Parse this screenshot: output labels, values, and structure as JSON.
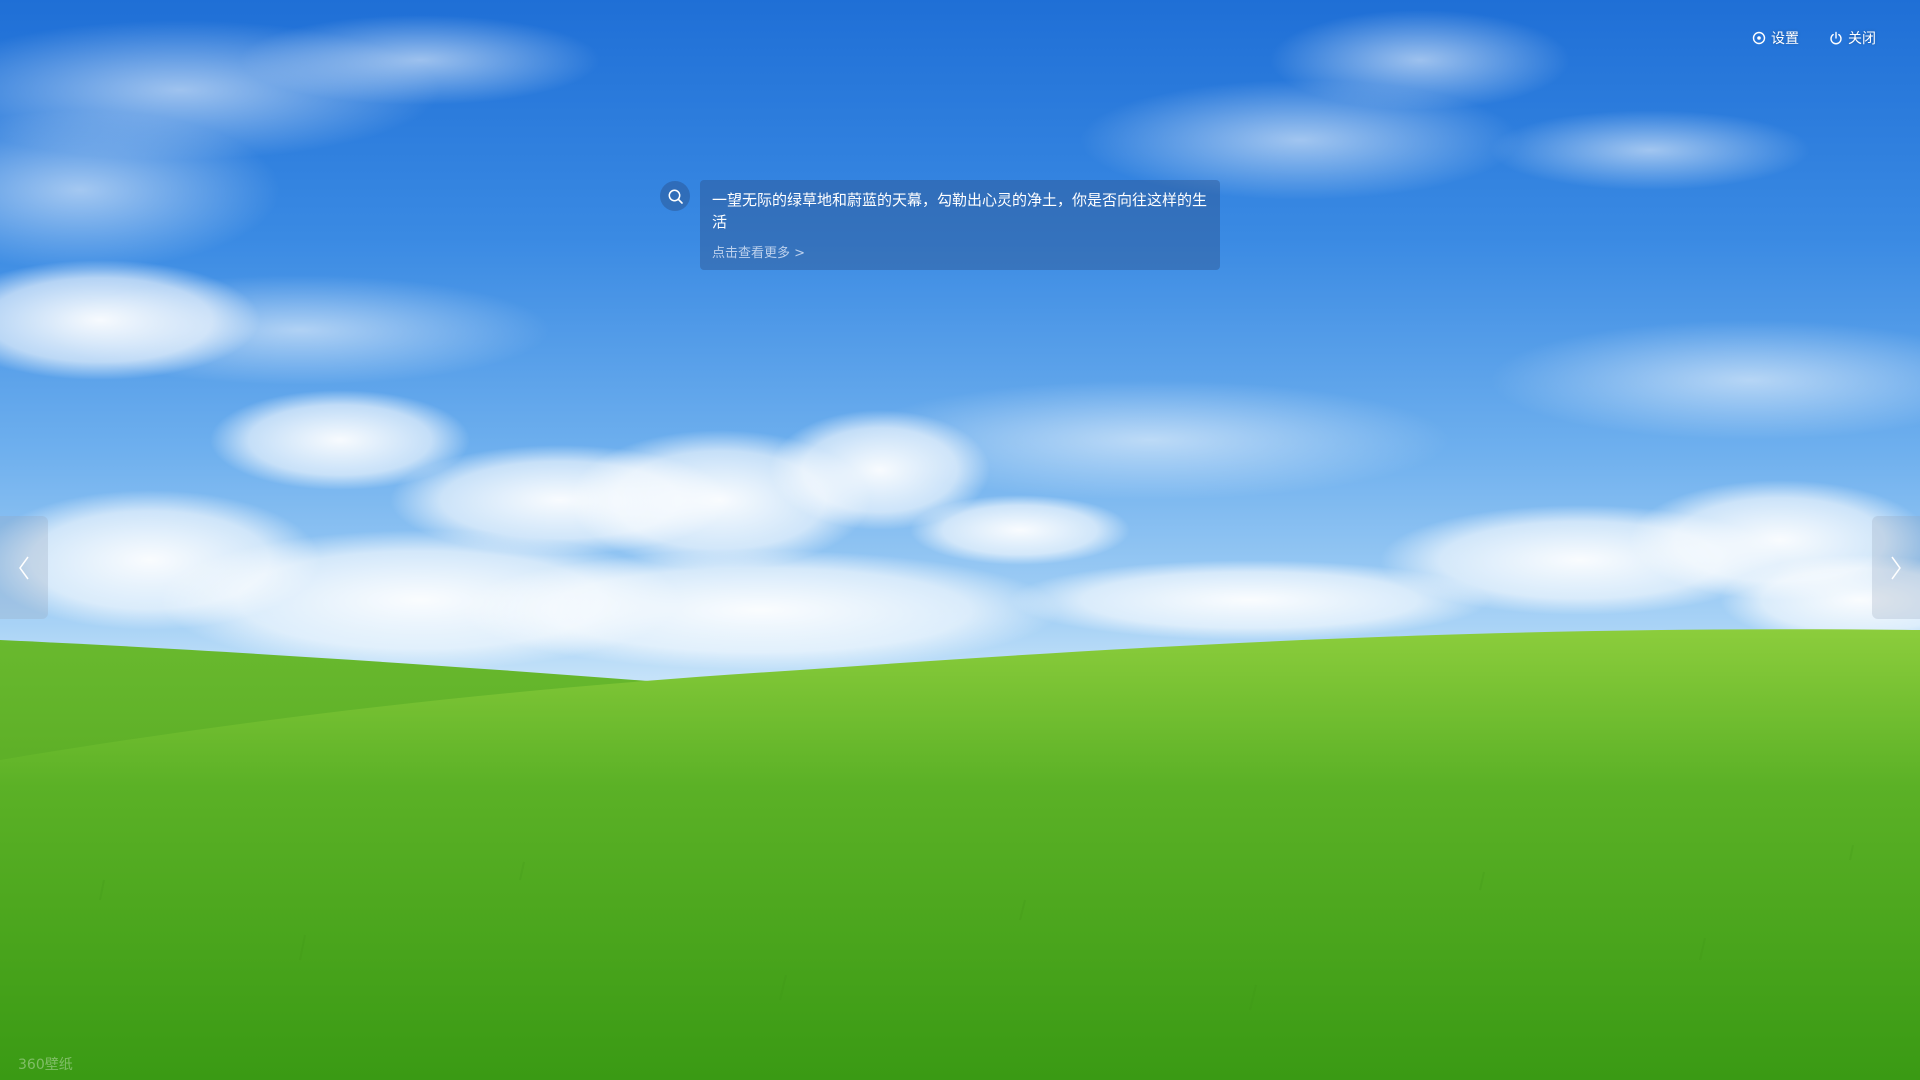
{
  "topbar": {
    "settings_label": "设置",
    "settings_icon": "settings-icon",
    "close_label": "关闭",
    "close_icon": "power-icon"
  },
  "info_card": {
    "title": "一望无际的绿草地和蔚蓝的天幕，勾勒出心灵的净土，你是否向往这样的生活",
    "more_link": "点击查看更多 >",
    "search_icon": "search-icon"
  },
  "navigation": {
    "prev_icon": "chevron-left-icon",
    "next_icon": "chevron-right-icon"
  },
  "watermark": "360壁纸",
  "colors": {
    "sky_top": "#1f6fd6",
    "sky_horizon": "#e8f5fc",
    "grass": "#4aa81e",
    "card_bg": "rgba(45,80,135,0.42)"
  }
}
